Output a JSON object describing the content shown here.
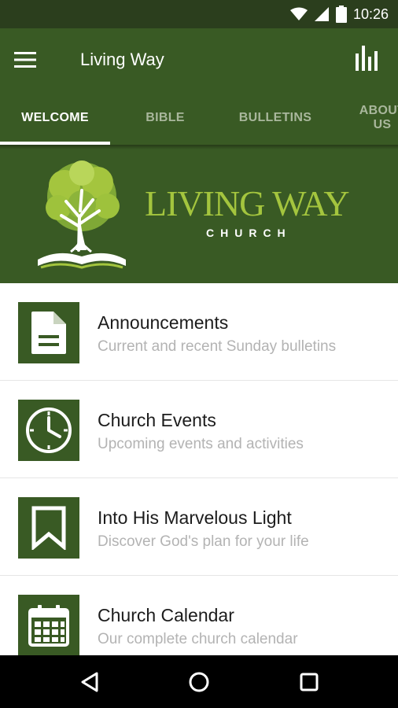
{
  "status_bar": {
    "time": "10:26",
    "icons": [
      "wifi-icon",
      "signal-icon",
      "battery-icon"
    ]
  },
  "app_bar": {
    "title": "Living Way",
    "menu_icon": "hamburger-menu-icon",
    "action_icon": "bar-chart-icon"
  },
  "tabs": [
    {
      "label": "WELCOME",
      "active": true
    },
    {
      "label": "BIBLE",
      "active": false
    },
    {
      "label": "BULLETINS",
      "active": false
    },
    {
      "label": "ABOUT US",
      "active": false
    }
  ],
  "banner": {
    "name": "LIVING WAY",
    "subtitle": "CHURCH",
    "logo_icon": "tree-on-bible-logo"
  },
  "list": [
    {
      "title": "Announcements",
      "subtitle": "Current and recent Sunday bulletins",
      "icon": "document-icon"
    },
    {
      "title": "Church Events",
      "subtitle": "Upcoming events and activities",
      "icon": "clock-icon"
    },
    {
      "title": "Into His Marvelous Light",
      "subtitle": "Discover God's plan for your life",
      "icon": "bookmark-icon"
    },
    {
      "title": "Church Calendar",
      "subtitle": "Our complete church calendar",
      "icon": "calendar-icon"
    }
  ],
  "nav_bar": {
    "icons": [
      "back-icon",
      "home-icon",
      "recents-icon"
    ]
  },
  "colors": {
    "primary": "#395a24",
    "primary_dark": "#2b3e1d",
    "accent": "#a4c53e",
    "tab_inactive": "#a9b79c",
    "subtitle_text": "#b3b3b3"
  }
}
